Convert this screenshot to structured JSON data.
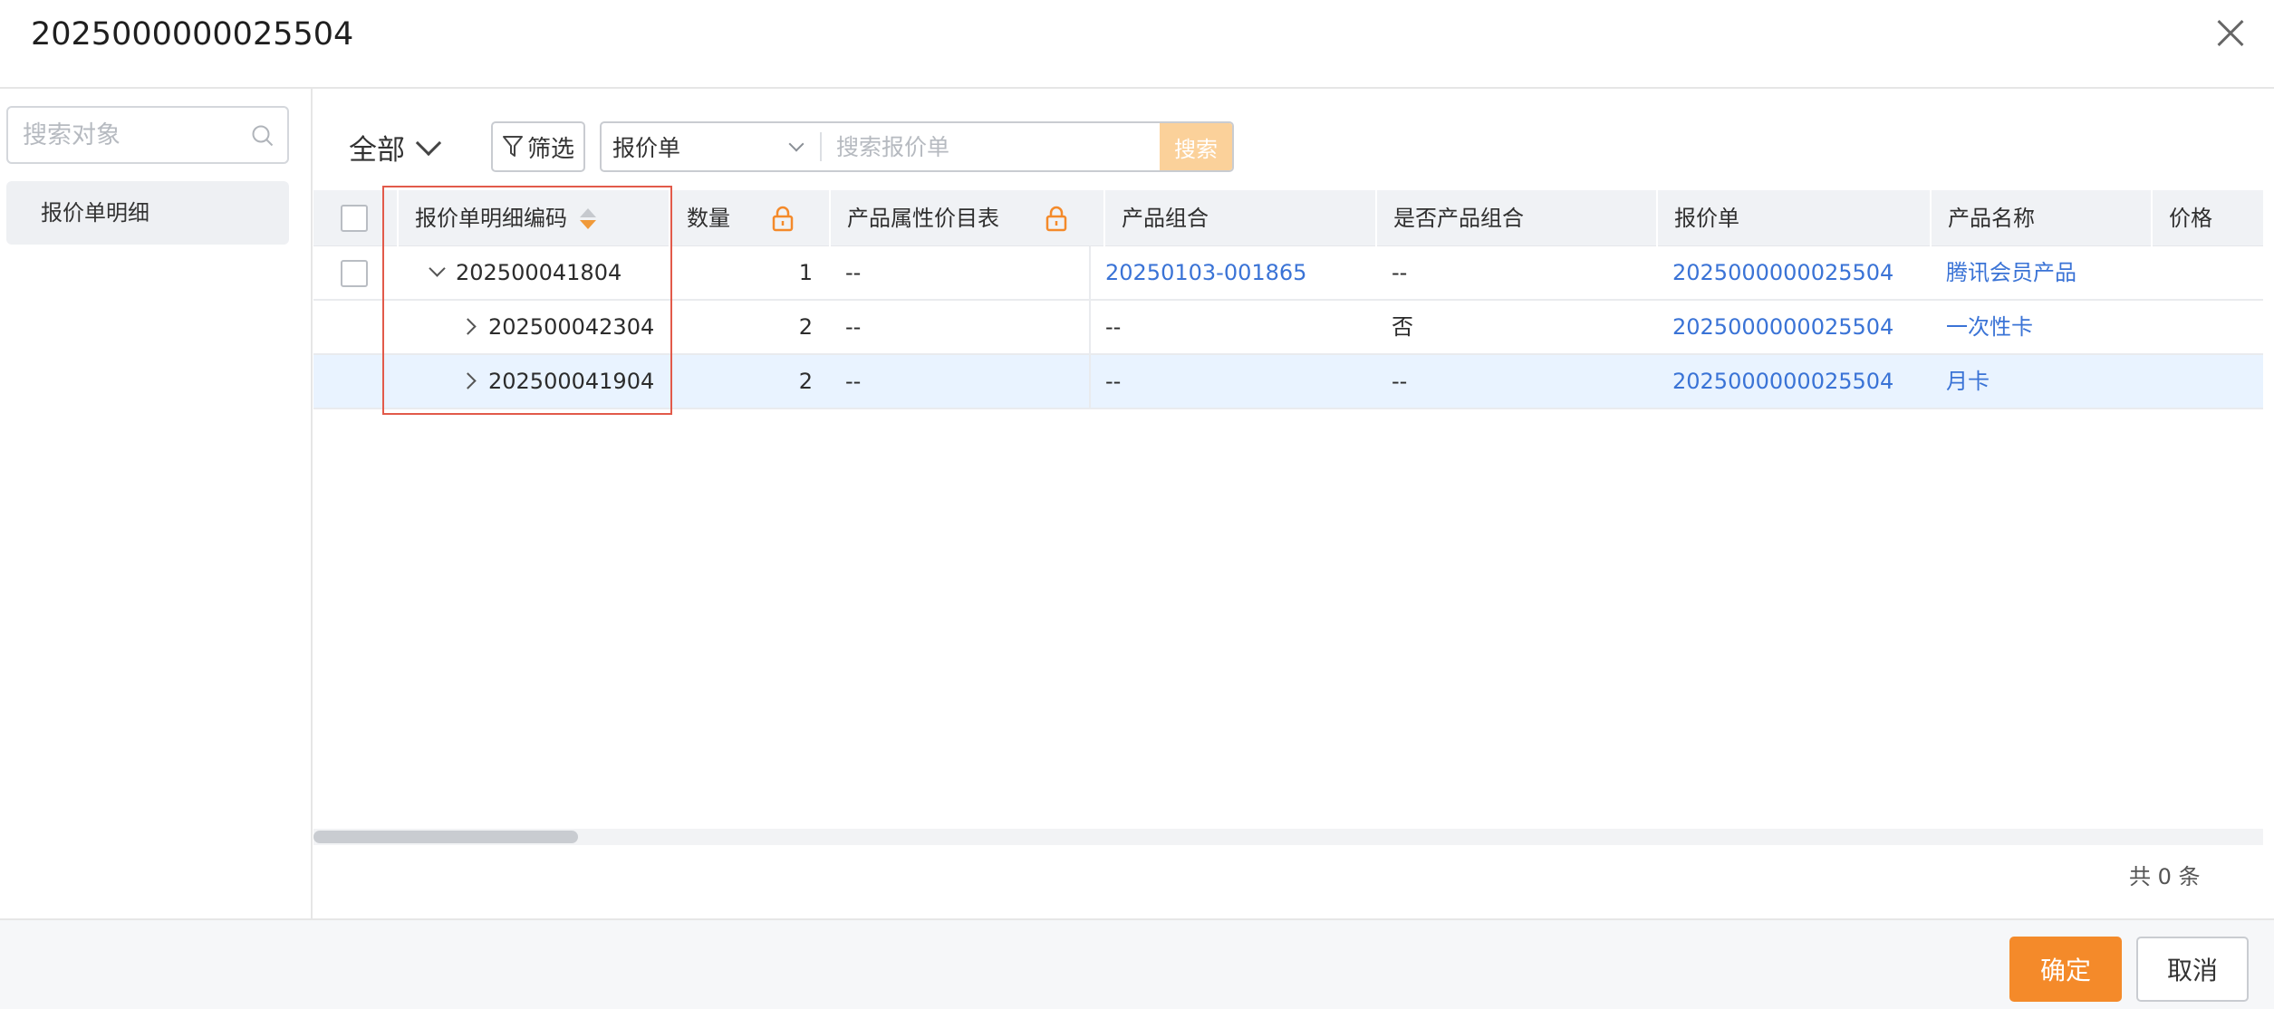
{
  "dialog": {
    "title": "2025000000025504"
  },
  "sidebar": {
    "search_placeholder": "搜索对象",
    "items": [
      {
        "label": "报价单明细"
      }
    ]
  },
  "toolbar": {
    "scope_label": "全部",
    "filter_label": "筛选",
    "search_type": "报价单",
    "search_placeholder": "搜索报价单",
    "search_button": "搜索"
  },
  "table": {
    "columns": [
      {
        "label": "报价单明细编码"
      },
      {
        "label": "数量"
      },
      {
        "label": "产品属性价目表"
      },
      {
        "label": "产品组合"
      },
      {
        "label": "是否产品组合"
      },
      {
        "label": "报价单"
      },
      {
        "label": "产品名称"
      },
      {
        "label": "价格"
      }
    ],
    "rows": [
      {
        "code": "202500041804",
        "qty": "1",
        "attr_price_list": "--",
        "bundle": "20250103-001865",
        "is_bundle": "--",
        "quote": "2025000000025504",
        "product": "腾讯会员产品"
      },
      {
        "code": "202500042304",
        "qty": "2",
        "attr_price_list": "--",
        "bundle": "--",
        "is_bundle": "否",
        "quote": "2025000000025504",
        "product": "一次性卡"
      },
      {
        "code": "202500041904",
        "qty": "2",
        "attr_price_list": "--",
        "bundle": "--",
        "is_bundle": "--",
        "quote": "2025000000025504",
        "product": "月卡"
      }
    ],
    "total_label": "共 0 条"
  },
  "footer": {
    "ok_label": "确定",
    "cancel_label": "取消"
  },
  "colors": {
    "accent": "#f48a2a",
    "link": "#3a73d6",
    "highlight_row": "#e9f3ff",
    "annotation_box": "#e25a4a"
  }
}
